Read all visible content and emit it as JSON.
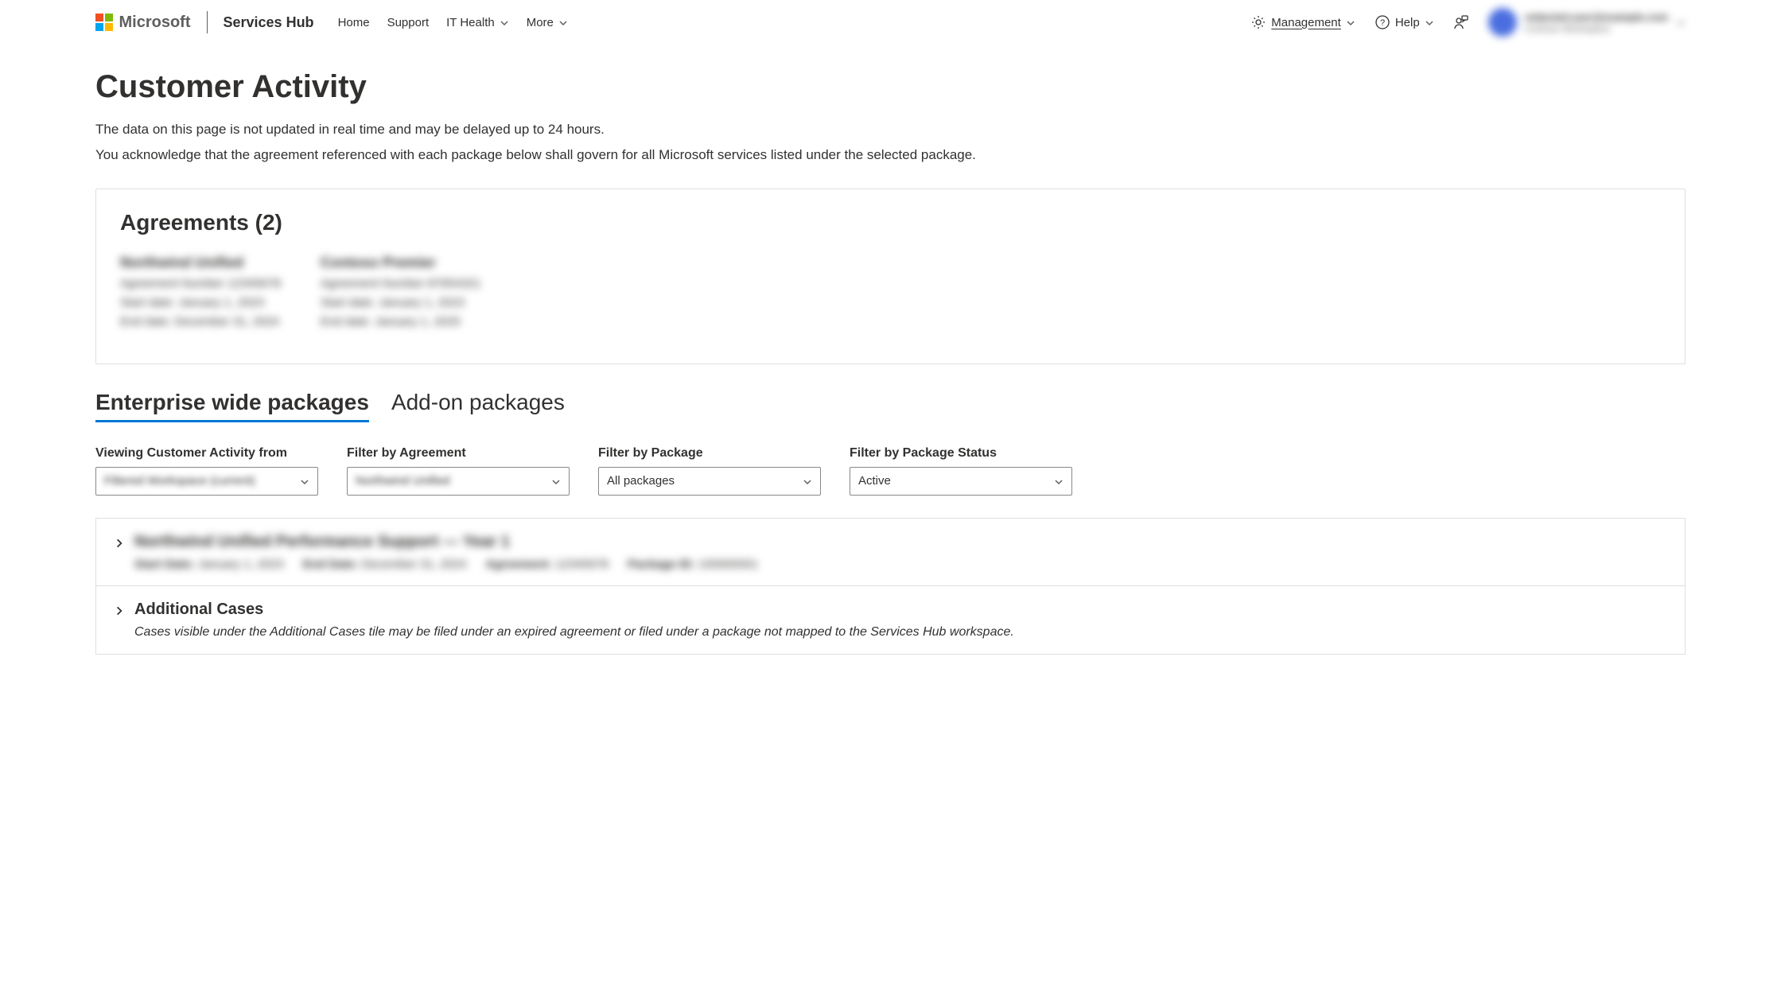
{
  "header": {
    "brand": "Microsoft",
    "product": "Services Hub",
    "nav": {
      "home": "Home",
      "support": "Support",
      "it_health": "IT Health",
      "more": "More",
      "management": "Management",
      "help": "Help"
    },
    "account": {
      "line1": "redacted.user@example.com",
      "line2": "Contoso Workspace"
    }
  },
  "page": {
    "title": "Customer Activity",
    "subtitle1": "The data on this page is not updated in real time and may be delayed up to 24 hours.",
    "subtitle2": "You acknowledge that the agreement referenced with each package below shall govern for all Microsoft services listed under the selected package."
  },
  "agreements": {
    "title": "Agreements (2)",
    "items": [
      {
        "name": "Northwind Unified",
        "number_label": "Agreement Number",
        "number_value": "12345678",
        "start_label": "Start date:",
        "start_value": "January 1, 2023",
        "end_label": "End date:",
        "end_value": "December 31, 2024"
      },
      {
        "name": "Contoso Premier",
        "number_label": "Agreement Number",
        "number_value": "87654321",
        "start_label": "Start date:",
        "start_value": "January 1, 2023",
        "end_label": "End date:",
        "end_value": "January 1, 2025"
      }
    ]
  },
  "tabs": {
    "enterprise": "Enterprise wide packages",
    "addon": "Add-on packages"
  },
  "filters": {
    "viewing_label": "Viewing Customer Activity from",
    "viewing_value": "Filtered Workspace (current)",
    "agreement_label": "Filter by Agreement",
    "agreement_value": "Northwind Unified",
    "package_label": "Filter by Package",
    "package_value": "All packages",
    "status_label": "Filter by Package Status",
    "status_value": "Active"
  },
  "packages": {
    "row1": {
      "title": "Northwind Unified Performance Support — Year 1",
      "start_label": "Start Date:",
      "start_value": "January 1, 2023",
      "end_label": "End Date:",
      "end_value": "December 31, 2024",
      "agreement_label": "Agreement:",
      "agreement_value": "12345678",
      "package_id_label": "Package ID:",
      "package_id_value": "100000001"
    },
    "additional": {
      "title": "Additional Cases",
      "desc": "Cases visible under the Additional Cases tile may be filed under an expired agreement or filed under a package not mapped to the Services Hub workspace."
    }
  }
}
